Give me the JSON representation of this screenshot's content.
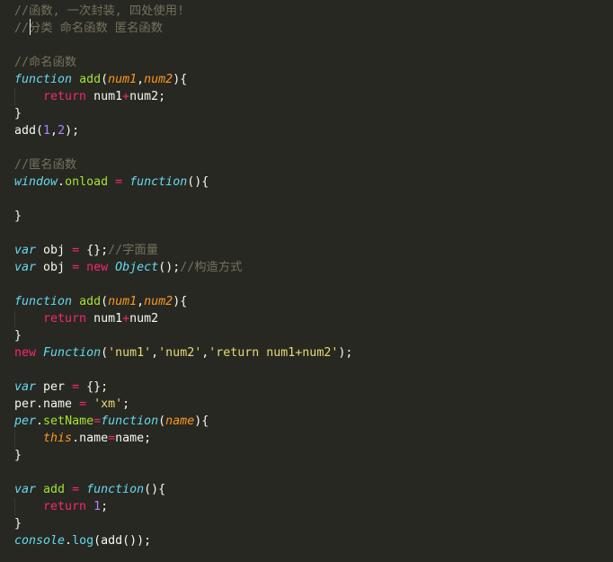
{
  "editor": {
    "theme": "monokai",
    "colors": {
      "background": "#272822",
      "text": "#f8f8f2",
      "comment": "#75715e",
      "keyword": "#f92672",
      "storage": "#66d9ef",
      "function": "#a6e22e",
      "parameter": "#fd971f",
      "number": "#ae81ff",
      "string": "#e6db74"
    },
    "lines": [
      [
        {
          "t": "comment",
          "v": "//函数, 一次封装, 四处使用!"
        }
      ],
      [
        {
          "t": "comment",
          "v": "//分类 命名函数 匿名函数"
        }
      ],
      [],
      [
        {
          "t": "comment",
          "v": "//命名函数"
        }
      ],
      [
        {
          "t": "storage",
          "v": "function"
        },
        {
          "t": "plain",
          "v": " "
        },
        {
          "t": "fn",
          "v": "add"
        },
        {
          "t": "plain",
          "v": "("
        },
        {
          "t": "param",
          "v": "num1"
        },
        {
          "t": "plain",
          "v": ","
        },
        {
          "t": "param",
          "v": "num2"
        },
        {
          "t": "plain",
          "v": "){"
        }
      ],
      [
        {
          "t": "plain",
          "v": "    "
        },
        {
          "t": "kw",
          "v": "return"
        },
        {
          "t": "plain",
          "v": " num1"
        },
        {
          "t": "op",
          "v": "+"
        },
        {
          "t": "plain",
          "v": "num2;"
        }
      ],
      [
        {
          "t": "plain",
          "v": "}"
        }
      ],
      [
        {
          "t": "plain",
          "v": "add("
        },
        {
          "t": "num",
          "v": "1"
        },
        {
          "t": "plain",
          "v": ","
        },
        {
          "t": "num",
          "v": "2"
        },
        {
          "t": "plain",
          "v": ");"
        }
      ],
      [],
      [
        {
          "t": "comment",
          "v": "//匿名函数"
        }
      ],
      [
        {
          "t": "support",
          "v": "window"
        },
        {
          "t": "plain",
          "v": "."
        },
        {
          "t": "fn",
          "v": "onload"
        },
        {
          "t": "plain",
          "v": " "
        },
        {
          "t": "op",
          "v": "="
        },
        {
          "t": "plain",
          "v": " "
        },
        {
          "t": "storage",
          "v": "function"
        },
        {
          "t": "plain",
          "v": "(){"
        }
      ],
      [],
      [
        {
          "t": "plain",
          "v": "}"
        }
      ],
      [],
      [
        {
          "t": "storage",
          "v": "var"
        },
        {
          "t": "plain",
          "v": " obj "
        },
        {
          "t": "op",
          "v": "="
        },
        {
          "t": "plain",
          "v": " {};"
        },
        {
          "t": "comment",
          "v": "//字面量"
        }
      ],
      [
        {
          "t": "storage",
          "v": "var"
        },
        {
          "t": "plain",
          "v": " obj "
        },
        {
          "t": "op",
          "v": "="
        },
        {
          "t": "plain",
          "v": " "
        },
        {
          "t": "kw",
          "v": "new"
        },
        {
          "t": "plain",
          "v": " "
        },
        {
          "t": "support",
          "v": "Object"
        },
        {
          "t": "plain",
          "v": "();"
        },
        {
          "t": "comment",
          "v": "//构造方式"
        }
      ],
      [],
      [
        {
          "t": "storage",
          "v": "function"
        },
        {
          "t": "plain",
          "v": " "
        },
        {
          "t": "fn",
          "v": "add"
        },
        {
          "t": "plain",
          "v": "("
        },
        {
          "t": "param",
          "v": "num1"
        },
        {
          "t": "plain",
          "v": ","
        },
        {
          "t": "param",
          "v": "num2"
        },
        {
          "t": "plain",
          "v": "){"
        }
      ],
      [
        {
          "t": "plain",
          "v": "    "
        },
        {
          "t": "kw",
          "v": "return"
        },
        {
          "t": "plain",
          "v": " num1"
        },
        {
          "t": "op",
          "v": "+"
        },
        {
          "t": "plain",
          "v": "num2"
        }
      ],
      [
        {
          "t": "plain",
          "v": "}"
        }
      ],
      [
        {
          "t": "kw",
          "v": "new"
        },
        {
          "t": "plain",
          "v": " "
        },
        {
          "t": "support",
          "v": "Function"
        },
        {
          "t": "plain",
          "v": "("
        },
        {
          "t": "str",
          "v": "'num1'"
        },
        {
          "t": "plain",
          "v": ","
        },
        {
          "t": "str",
          "v": "'num2'"
        },
        {
          "t": "plain",
          "v": ","
        },
        {
          "t": "str",
          "v": "'return num1+num2'"
        },
        {
          "t": "plain",
          "v": ");"
        }
      ],
      [],
      [
        {
          "t": "storage",
          "v": "var"
        },
        {
          "t": "plain",
          "v": " per "
        },
        {
          "t": "op",
          "v": "="
        },
        {
          "t": "plain",
          "v": " {};"
        }
      ],
      [
        {
          "t": "plain",
          "v": "per.name "
        },
        {
          "t": "op",
          "v": "="
        },
        {
          "t": "plain",
          "v": " "
        },
        {
          "t": "str",
          "v": "'xm'"
        },
        {
          "t": "plain",
          "v": ";"
        }
      ],
      [
        {
          "t": "support",
          "v": "per"
        },
        {
          "t": "plain",
          "v": "."
        },
        {
          "t": "fn",
          "v": "setName"
        },
        {
          "t": "op",
          "v": "="
        },
        {
          "t": "storage",
          "v": "function"
        },
        {
          "t": "plain",
          "v": "("
        },
        {
          "t": "param",
          "v": "name"
        },
        {
          "t": "plain",
          "v": "){"
        }
      ],
      [
        {
          "t": "plain",
          "v": "    "
        },
        {
          "t": "param",
          "v": "this"
        },
        {
          "t": "plain",
          "v": ".name"
        },
        {
          "t": "op",
          "v": "="
        },
        {
          "t": "plain",
          "v": "name;"
        }
      ],
      [
        {
          "t": "plain",
          "v": "}"
        }
      ],
      [],
      [
        {
          "t": "storage",
          "v": "var"
        },
        {
          "t": "plain",
          "v": " "
        },
        {
          "t": "fn",
          "v": "add"
        },
        {
          "t": "plain",
          "v": " "
        },
        {
          "t": "op",
          "v": "="
        },
        {
          "t": "plain",
          "v": " "
        },
        {
          "t": "storage",
          "v": "function"
        },
        {
          "t": "plain",
          "v": "(){"
        }
      ],
      [
        {
          "t": "plain",
          "v": "    "
        },
        {
          "t": "kw",
          "v": "return"
        },
        {
          "t": "plain",
          "v": " "
        },
        {
          "t": "num",
          "v": "1"
        },
        {
          "t": "plain",
          "v": ";"
        }
      ],
      [
        {
          "t": "plain",
          "v": "}"
        }
      ],
      [
        {
          "t": "support",
          "v": "console"
        },
        {
          "t": "plain",
          "v": "."
        },
        {
          "t": "supportfn",
          "v": "log"
        },
        {
          "t": "plain",
          "v": "(add());"
        }
      ]
    ]
  }
}
